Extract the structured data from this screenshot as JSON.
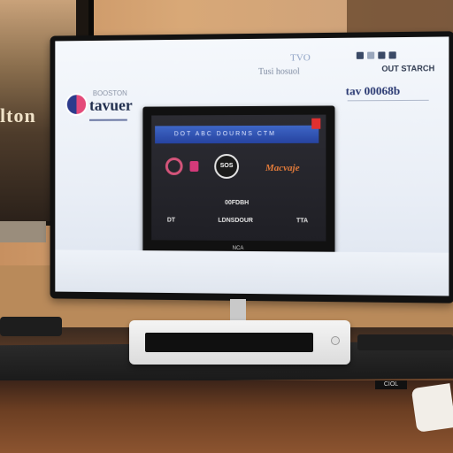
{
  "background": {
    "caption": "lton"
  },
  "monitor": {
    "top_mini_label": "TVO",
    "top_text": "Tusi hosuol",
    "top_right_label": "OUT STARCH",
    "small_heading": "BOOSTON",
    "brand_title": "tavuer",
    "phone": "tav 00068b"
  },
  "tv": {
    "bar_text": "DOT ABC DOURNS CTM",
    "logo_text": "SOS",
    "brand": "Macvaje",
    "mid_text": "00FDBH",
    "row": [
      "DT",
      "LDNSDOUR",
      "TTA"
    ],
    "bezel_label": "NCA"
  },
  "desk": {
    "badge": "CIOL"
  }
}
